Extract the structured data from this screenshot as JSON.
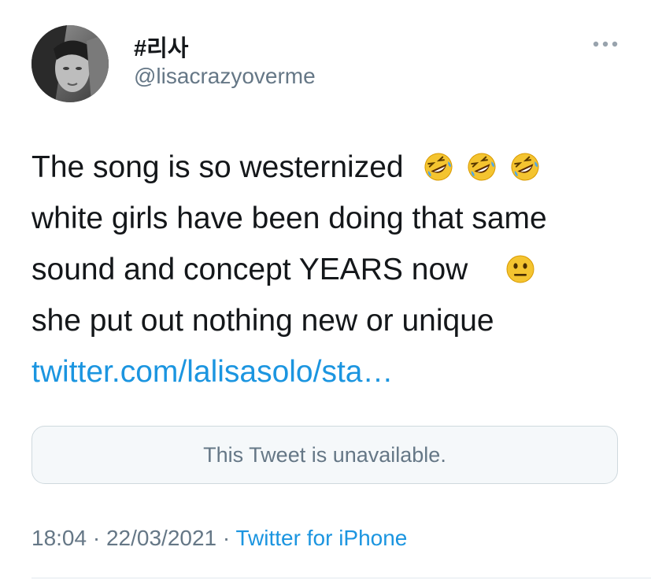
{
  "tweet": {
    "display_name": "#리사",
    "handle": "@lisacrazyoverme",
    "avatar_icon": "profile-photo",
    "more_icon": "ellipsis-icon",
    "text_lines": [
      "The song is so westernized",
      "white girls have been doing that same",
      "sound and concept YEARS now",
      "she put out nothing new or unique"
    ],
    "emojis": {
      "line1": [
        "rolling-on-the-floor-laughing-emoji",
        "rolling-on-the-floor-laughing-emoji",
        "rolling-on-the-floor-laughing-emoji"
      ],
      "line3": [
        "neutral-face-emoji"
      ]
    },
    "link_text": "twitter.com/lalisasolo/sta…",
    "quoted_tweet": "This Tweet is unavailable.",
    "time": "18:04",
    "separator": "·",
    "date": "22/03/2021",
    "source": "Twitter for iPhone"
  },
  "colors": {
    "text": "#14171a",
    "secondary": "#657786",
    "link": "#1b95e0",
    "quote_bg": "#f5f8fa",
    "border": "#cfd9de"
  }
}
